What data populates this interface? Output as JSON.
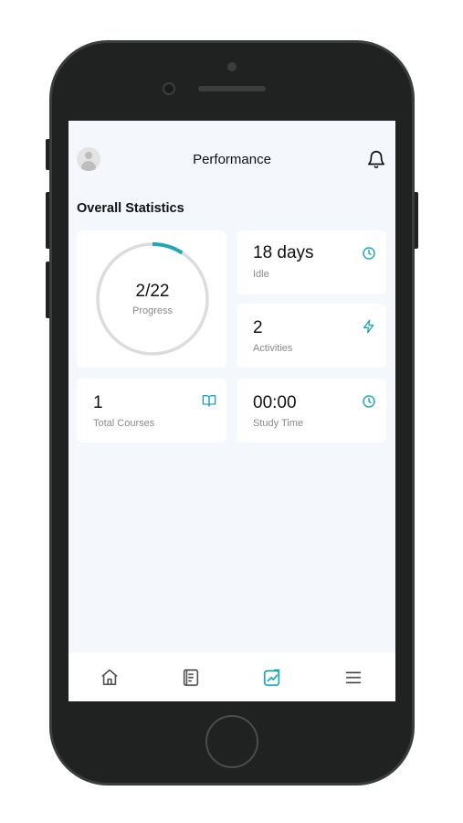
{
  "header": {
    "title": "Performance"
  },
  "section": {
    "title": "Overall Statistics"
  },
  "progress": {
    "value": "2/22",
    "label": "Progress",
    "completed": 2,
    "total": 22
  },
  "stats": {
    "idle": {
      "value": "18 days",
      "label": "Idle",
      "icon": "clock-icon"
    },
    "activities": {
      "value": "2",
      "label": "Activities",
      "icon": "lightning-icon"
    },
    "courses": {
      "value": "1",
      "label": "Total Courses",
      "icon": "book-icon"
    },
    "study_time": {
      "value": "00:00",
      "label": "Study Time",
      "icon": "clock-icon"
    }
  },
  "tabs": [
    {
      "name": "home",
      "icon": "home-icon",
      "active": false
    },
    {
      "name": "courses",
      "icon": "document-icon",
      "active": false
    },
    {
      "name": "performance",
      "icon": "chart-icon",
      "active": true
    },
    {
      "name": "menu",
      "icon": "menu-icon",
      "active": false
    }
  ],
  "colors": {
    "accent": "#1fa8b5",
    "background": "#f4f8fd",
    "ring_track": "#dcdcdc",
    "inactive_icon": "#555555"
  }
}
